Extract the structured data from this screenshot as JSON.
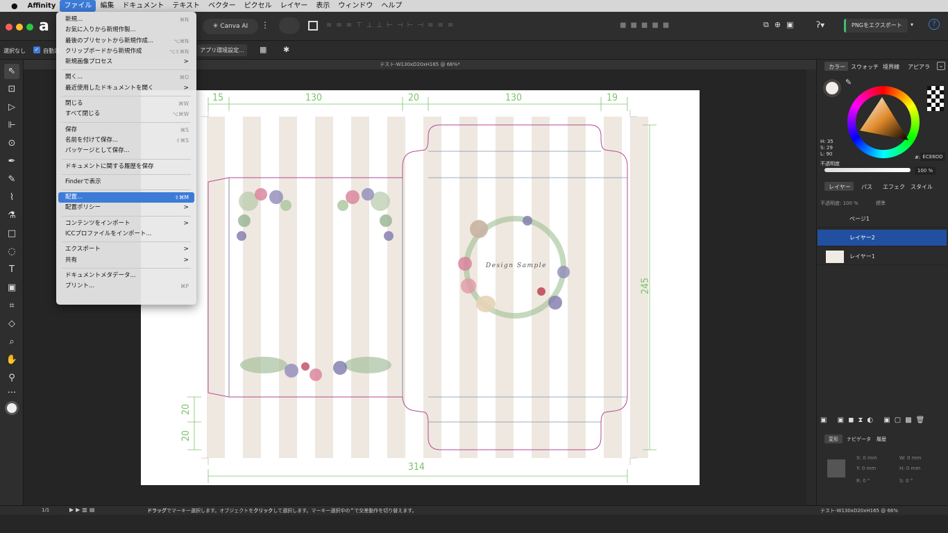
{
  "menubar": {
    "apple": "",
    "items": [
      "Affinity",
      "ファイル",
      "編集",
      "ドキュメント",
      "テキスト",
      "ベクター",
      "ピクセル",
      "レイヤー",
      "表示",
      "ウィンドウ",
      "ヘルプ"
    ]
  },
  "toolbar": {
    "canva_ai": "Canva AI",
    "export_button": "PNGをエクスポート"
  },
  "context_toolbar": {
    "selection": "選択なし",
    "auto_select": "自動選",
    "app_settings": "アプリ環境設定..."
  },
  "document": {
    "title": "テスト-W130xD20xH165 @ 66%*"
  },
  "file_menu": {
    "items": [
      {
        "label": "新規...",
        "shortcut": "⌘N"
      },
      {
        "label": "お気に入りから新規作製...",
        "shortcut": ""
      },
      {
        "label": "最後のプリセットから新規作成...",
        "shortcut": "⌥⌘N"
      },
      {
        "label": "クリップボードから新規作成",
        "shortcut": "⌥⇧⌘N"
      },
      {
        "label": "新規画像プロセス",
        "shortcut": ">"
      },
      {
        "label": "開く...",
        "shortcut": "⌘O"
      },
      {
        "label": "最近使用したドキュメントを開く",
        "shortcut": ">"
      },
      {
        "label": "閉じる",
        "shortcut": "⌘W"
      },
      {
        "label": "すべて閉じる",
        "shortcut": "⌥⌘W"
      },
      {
        "label": "保存",
        "shortcut": "⌘S"
      },
      {
        "label": "名前を付けて保存...",
        "shortcut": "⇧⌘S"
      },
      {
        "label": "パッケージとして保存...",
        "shortcut": ""
      },
      {
        "label": "ドキュメントに関する履歴を保存",
        "shortcut": ""
      },
      {
        "label": "Finderで表示",
        "shortcut": ""
      },
      {
        "label": "配置...",
        "shortcut": "⇧⌘M"
      },
      {
        "label": "配置ポリシー",
        "shortcut": ">"
      },
      {
        "label": "コンテンツをインポート",
        "shortcut": ">"
      },
      {
        "label": "ICCプロファイルをインポート...",
        "shortcut": ""
      },
      {
        "label": "エクスポート",
        "shortcut": ">"
      },
      {
        "label": "共有",
        "shortcut": ">"
      },
      {
        "label": "ドキュメントメタデータ...",
        "shortcut": ""
      },
      {
        "label": "プリント...",
        "shortcut": "⌘P"
      }
    ]
  },
  "dimensions": {
    "d15": "15",
    "d130a": "130",
    "d20": "20",
    "d130b": "130",
    "d19": "19",
    "d245": "245",
    "d20a": "20",
    "d20b": "20",
    "d314": "314"
  },
  "design_text": "Design Sample",
  "color_panel": {
    "tabs": [
      "カラー",
      "スウォッチ",
      "境界線",
      "アピアラ"
    ],
    "h": "H: 35",
    "s": "S: 29",
    "l": "L: 90",
    "opacity_label": "不透明度",
    "hex_label": "#:",
    "hex": "ECE6DD",
    "opacity_value": "100 %"
  },
  "layers_panel": {
    "tabs": [
      "レイヤー",
      "パス",
      "エフェク",
      "スタイル"
    ],
    "opacity": "不透明度: 100 %",
    "blend": "標準",
    "layers": [
      "ページ1",
      "レイヤー2",
      "レイヤー1"
    ]
  },
  "transform_panel": {
    "tabs": [
      "変形",
      "ナビゲータ",
      "履歴"
    ],
    "x": "X: 0 mm",
    "y": "Y: 0 mm",
    "w": "W: 0 mm",
    "h": "H: 0 mm",
    "r": "R: 0 °",
    "s": "S: 0 °"
  },
  "status": {
    "page": "1/1",
    "hint_drag": "ドラッグ",
    "hint_rest1": "でマーキー選択します。オブジェクトを",
    "hint_click": "クリック",
    "hint_rest2": "して選択します。マーキー選択中の",
    "hint_caret": "^",
    "hint_rest3": "で交差動作を切り替えます。",
    "right": "テスト-W130xD20xH165 @ 66%"
  },
  "colors": {
    "accent": "#3d7bd8",
    "stripe": "#efe8e0",
    "dieline": "#b14a94",
    "dimension": "#7bc36a"
  }
}
